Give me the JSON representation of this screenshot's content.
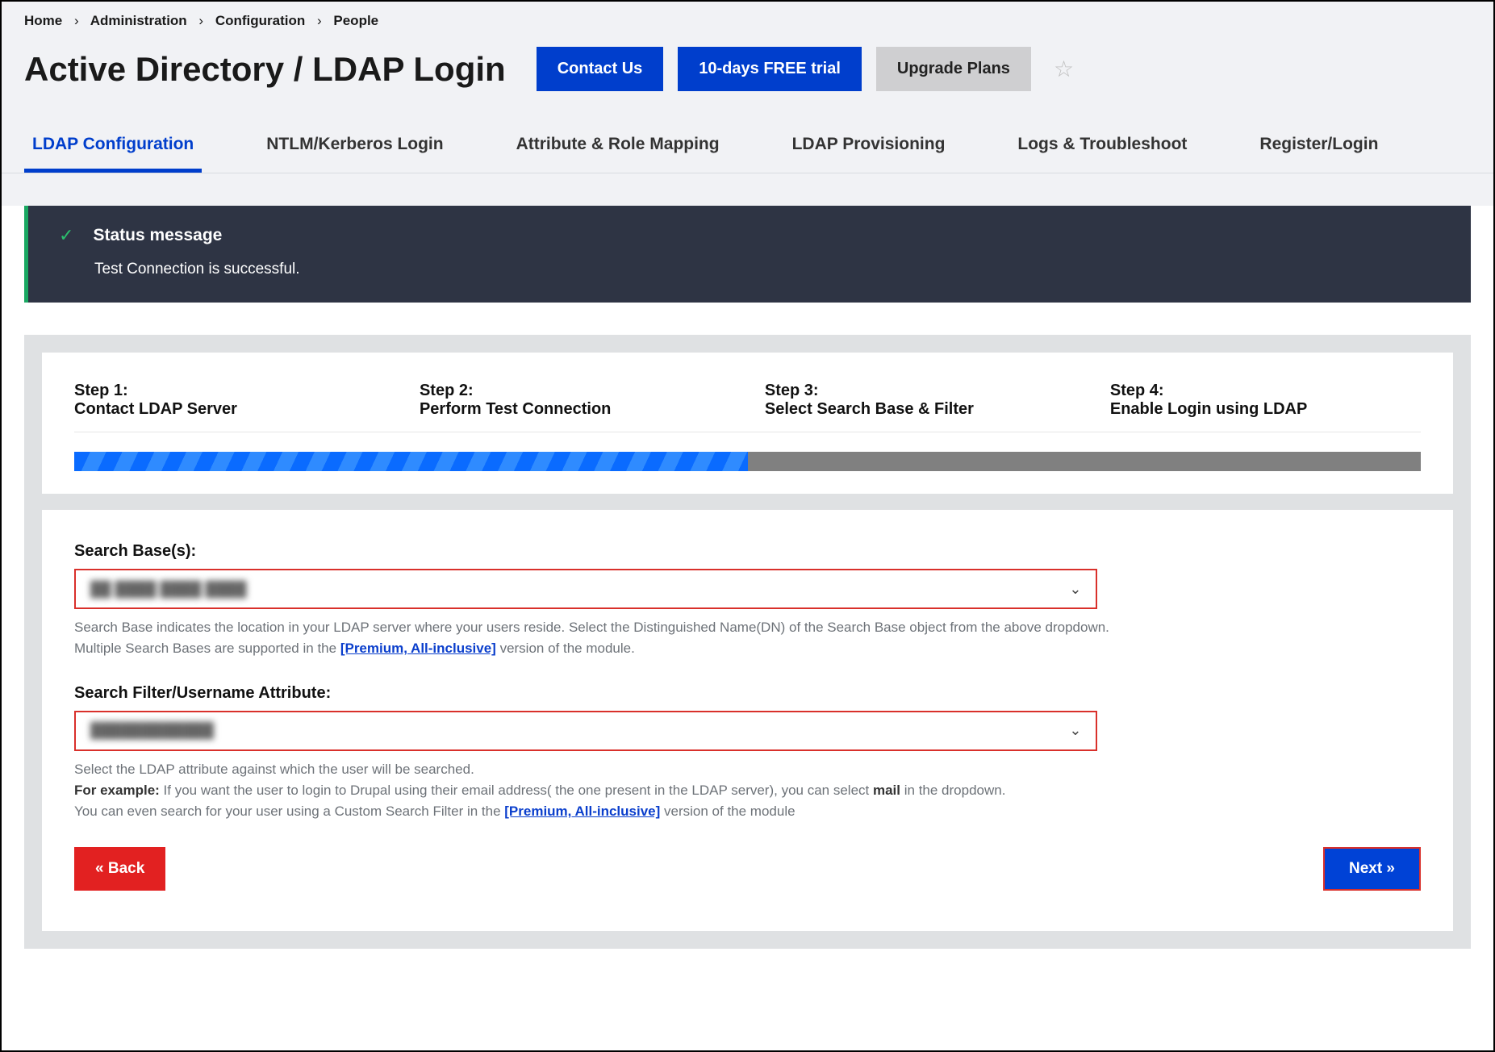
{
  "breadcrumb": [
    "Home",
    "Administration",
    "Configuration",
    "People"
  ],
  "page_title": "Active Directory / LDAP Login",
  "header_buttons": {
    "contact": "Contact Us",
    "trial": "10-days FREE trial",
    "upgrade": "Upgrade Plans"
  },
  "tabs": [
    "LDAP Configuration",
    "NTLM/Kerberos Login",
    "Attribute & Role Mapping",
    "LDAP Provisioning",
    "Logs & Troubleshoot",
    "Register/Login"
  ],
  "active_tab_index": 0,
  "status": {
    "title": "Status message",
    "message": "Test Connection is successful."
  },
  "steps": [
    {
      "label": "Step 1:",
      "desc": "Contact LDAP Server"
    },
    {
      "label": "Step 2:",
      "desc": "Perform Test Connection"
    },
    {
      "label": "Step 3:",
      "desc": "Select Search Base & Filter"
    },
    {
      "label": "Step 4:",
      "desc": "Enable Login using LDAP"
    }
  ],
  "progress_pct": 50,
  "search_base": {
    "label": "Search Base(s):",
    "value": "██ ████ ████ ████",
    "help1": "Search Base indicates the location in your LDAP server where your users reside. Select the Distinguished Name(DN) of the Search Base object from the above dropdown.",
    "help2a": "Multiple Search Bases are supported in the ",
    "help2_link": "[Premium, All-inclusive]",
    "help2b": " version of the module."
  },
  "search_filter": {
    "label": "Search Filter/Username Attribute:",
    "value": "████████████",
    "help1": "Select the LDAP attribute against which the user will be searched.",
    "help2a": "For example:",
    "help2b": " If you want the user to login to Drupal using their email address( the one present in the LDAP server), you can select ",
    "help2c": "mail",
    "help2d": " in the dropdown.",
    "help3a": "You can even search for your user using a Custom Search Filter in the ",
    "help3_link": "[Premium, All-inclusive]",
    "help3b": " version of the module"
  },
  "buttons": {
    "back": "« Back",
    "next": "Next »"
  }
}
